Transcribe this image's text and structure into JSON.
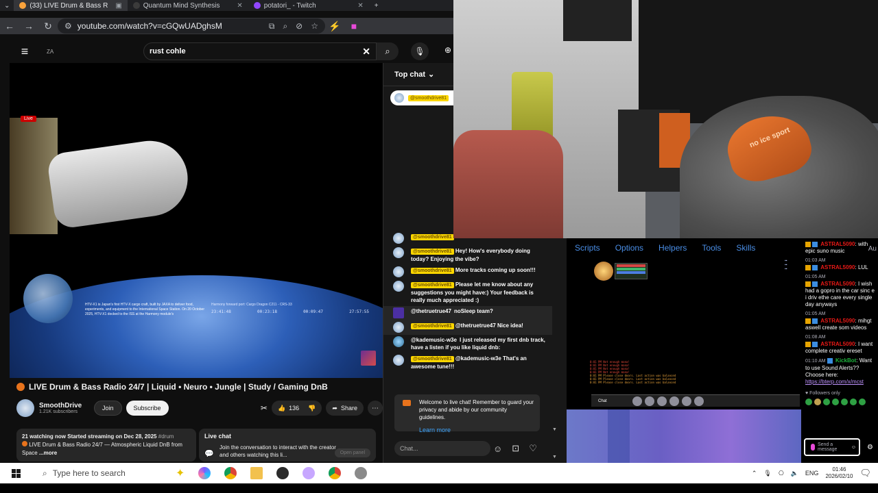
{
  "browser": {
    "tabs": [
      {
        "label": "(33) LIVE Drum & Bass R",
        "active": true,
        "color": "#f9a23c"
      },
      {
        "label": "Quantum Mind Synthesis",
        "active": false,
        "color": "#3b3b3b"
      },
      {
        "label": "potatori_ - Twitch",
        "active": false,
        "color": "#9146ff"
      }
    ],
    "url": "youtube.com/watch?v=cGQwUADghsM"
  },
  "youtube": {
    "logo_text": "ZA",
    "search_value": "rust cohle",
    "video": {
      "live_badge": "Live",
      "caption": "HTV-X1 is Japan's first HTV-X cargo craft, built by JAXA to deliver food, experiments, and equipment to the International Space Station. On 20 October 2025, HTV-X1 docked to the ISS at the Harmony module's",
      "telemetry_title": "Harmony forward port: Cargo Dragon C211 - CRS-33",
      "telemetry_values": [
        "23:41:48",
        "00:23:18",
        "00:09:47",
        "27:57:55"
      ]
    },
    "title": "LIVE Drum & Bass Radio 24/7 | Liquid • Neuro • Jungle | Study / Gaming DnB",
    "channel": {
      "name": "SmoothDrive",
      "subscribers": "1.21K subscribers"
    },
    "buttons": {
      "join": "Join",
      "subscribe": "Subscribe",
      "likes": "136",
      "share": "Share"
    },
    "description": {
      "line1": "21 watching now  Started streaming on Dec 28, 2025",
      "hashtag": "#drum",
      "line2": "LIVE Drum & Bass Radio 24/7 — Atmospheric Liquid DnB from Space",
      "more": "...more"
    },
    "live_chat_box": {
      "title": "Live chat",
      "text": "Join the conversation to interact with the creator and others watching this li...",
      "open_panel": "Open panel"
    }
  },
  "chat": {
    "header": "Top chat",
    "pinned_author": "@smoothdrive81",
    "messages": [
      {
        "author": "@smoothdrive81",
        "text": "",
        "highlight": true
      },
      {
        "author": "@smoothdrive81",
        "text": "Hey! How's everybody doing today? Enjoying the vibe?",
        "highlight": true
      },
      {
        "author": "@smoothdrive81",
        "text": "More tracks coming up soon!!!",
        "highlight": true
      },
      {
        "author": "@smoothdrive81",
        "text": "Please let me know about any suggestions you might have:) Your feedback is really much appreciated :)",
        "highlight": true
      },
      {
        "author": "@thetruetrue47",
        "text": "noSleep team?",
        "highlight": false
      },
      {
        "author": "@smoothdrive81",
        "text": "@thetruetrue47 Nice idea!",
        "highlight": true
      },
      {
        "author": "@kademusic-w3e",
        "text": "I just released my first dnb track, have a listen if you like liquid dnb:",
        "highlight": false
      },
      {
        "author": "@smoothdrive81",
        "text": "@kademusic-w3e That's an awesome tune!!!",
        "highlight": true
      }
    ],
    "welcome": "Welcome to live chat! Remember to guard your privacy and abide by our community guidelines.",
    "learn_more": "Learn more",
    "input_placeholder": "Chat..."
  },
  "webcam": {
    "cap_text": "no ice sport"
  },
  "game": {
    "menu": [
      "Scripts",
      "Options",
      "Helpers",
      "Tools",
      "Skills"
    ],
    "extra_menu": "Au",
    "log_lines": [
      "0:01 PM  Not enough mana!",
      "0:01 PM  Not enough mana!",
      "0:01 PM  Not enough mana!",
      "0:01 PM  Not enough mana!",
      "0:01 PM  Please close doors. Last action was balanced",
      "0:01 PM  Please close doors. Last action was balanced",
      "0:01 PM  Please close doors. Last action was balanced"
    ],
    "chat_label": "Chat"
  },
  "twitch": {
    "header": "Au",
    "messages": [
      {
        "time": "",
        "author": "ASTRAL5090",
        "text": "with epic suno music"
      },
      {
        "time": "01:03 AM",
        "author": "ASTRAL5090",
        "text": "LUL"
      },
      {
        "time": "01:05 AM",
        "author": "ASTRAL5090",
        "text": "I wish had a gopro in the car sinc e i driv ethe care every single day anyways"
      },
      {
        "time": "01:05 AM",
        "author": "ASTRAL5090",
        "text": "mihgt aswell create som videos"
      },
      {
        "time": "01:08 AM",
        "author": "ASTRAL5090",
        "text": "I want complete creativ ereset"
      }
    ],
    "bot": {
      "time": "01:10 AM",
      "author": "KickBot",
      "text": "Want to use Sound Alerts?? Choose here:",
      "link": "https://bterp.com/x/mcst"
    },
    "followers_only": "Followers only",
    "send_placeholder": "Send a message"
  },
  "taskbar": {
    "search_placeholder": "Type here to search",
    "lang": "ENG",
    "time": "01:46",
    "date": "2026/02/10"
  }
}
